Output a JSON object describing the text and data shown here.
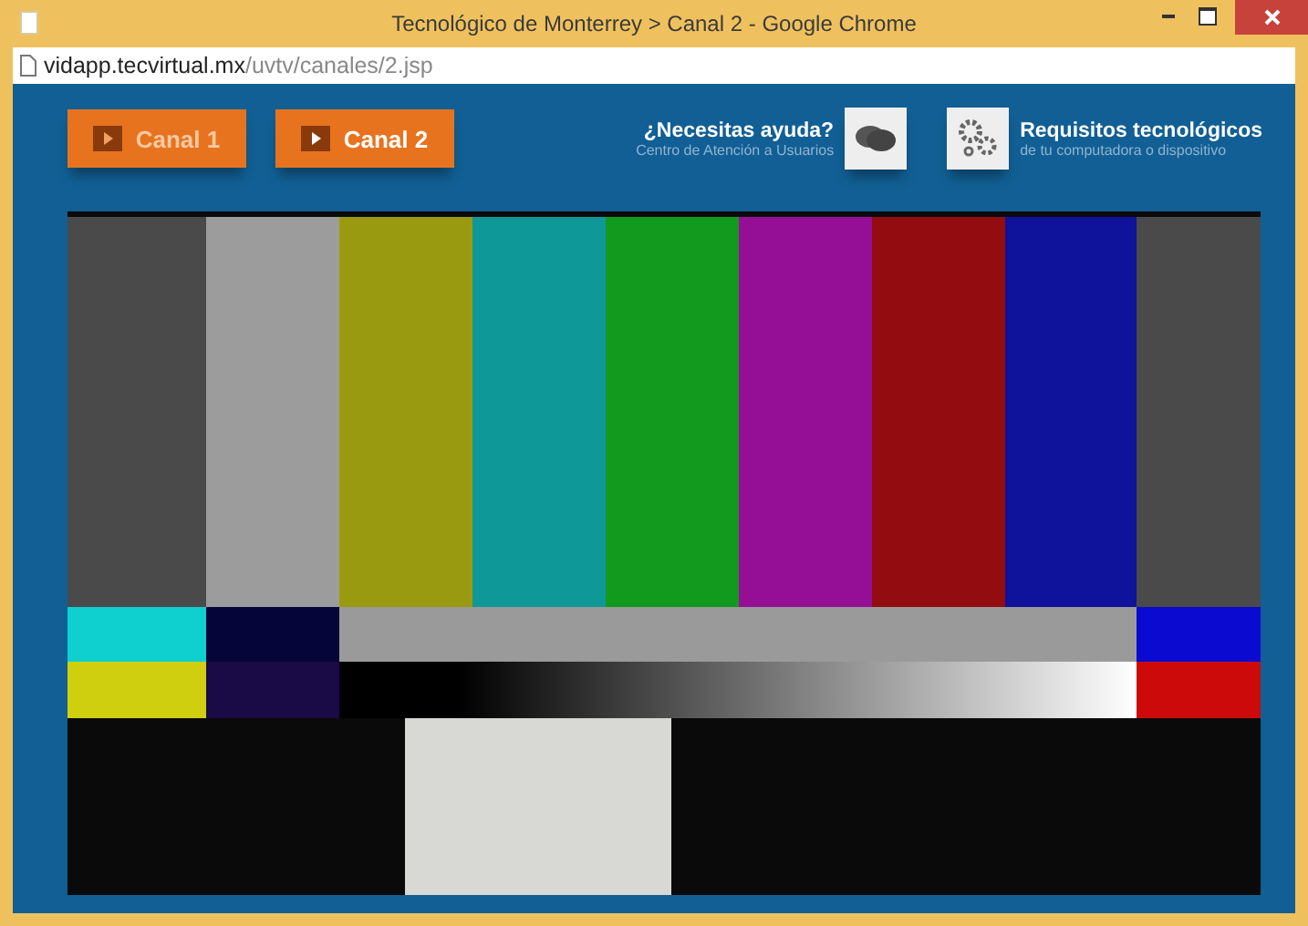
{
  "window": {
    "title": "Tecnológico de Monterrey > Canal 2 - Google Chrome"
  },
  "address_bar": {
    "host": "vidapp.tecvirtual.mx",
    "path": "/uvtv/canales/2.jsp"
  },
  "channels": [
    {
      "label": "Canal 1",
      "selected": false
    },
    {
      "label": "Canal 2",
      "selected": true
    }
  ],
  "help": {
    "title": "¿Necesitas ayuda?",
    "subtitle": "Centro de Atención a Usuarios"
  },
  "requirements": {
    "title": "Requisitos tecnológicos",
    "subtitle": "de tu computadora o dispositivo"
  }
}
